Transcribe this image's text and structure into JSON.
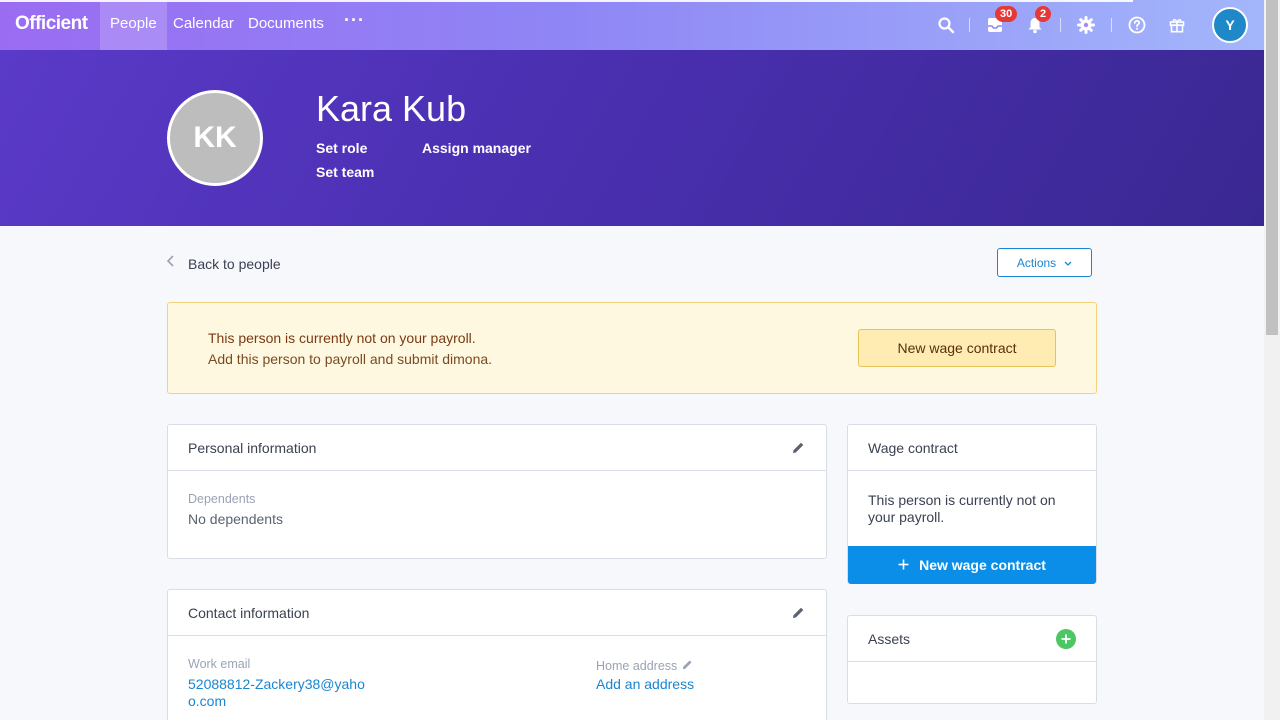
{
  "nav": {
    "logo": "Officient",
    "items": [
      "People",
      "Calendar",
      "Documents"
    ],
    "more": "···",
    "inbox_count": "30",
    "notifications_count": "2",
    "user_initial": "Y"
  },
  "profile": {
    "initials": "KK",
    "name": "Kara Kub",
    "set_role": "Set role",
    "assign_manager": "Assign manager",
    "set_team": "Set team"
  },
  "page": {
    "back_label": "Back to people",
    "actions_label": "Actions"
  },
  "alert": {
    "title": "This person is currently not on your payroll.",
    "subtitle": "Add this person to payroll and submit dimona.",
    "button": "New wage contract"
  },
  "personal": {
    "title": "Personal information",
    "dependents_label": "Dependents",
    "dependents_value": "No dependents"
  },
  "contact": {
    "title": "Contact information",
    "work_email_label": "Work email",
    "work_email_line1": "52088812-Zackery38@yaho",
    "work_email_line2": "o.com",
    "home_address_label": "Home address",
    "home_address_action": "Add an address"
  },
  "wage": {
    "title": "Wage contract",
    "text_line1": "This person is currently not on",
    "text_line2": "your payroll.",
    "button": "New wage contract"
  },
  "assets": {
    "title": "Assets"
  }
}
